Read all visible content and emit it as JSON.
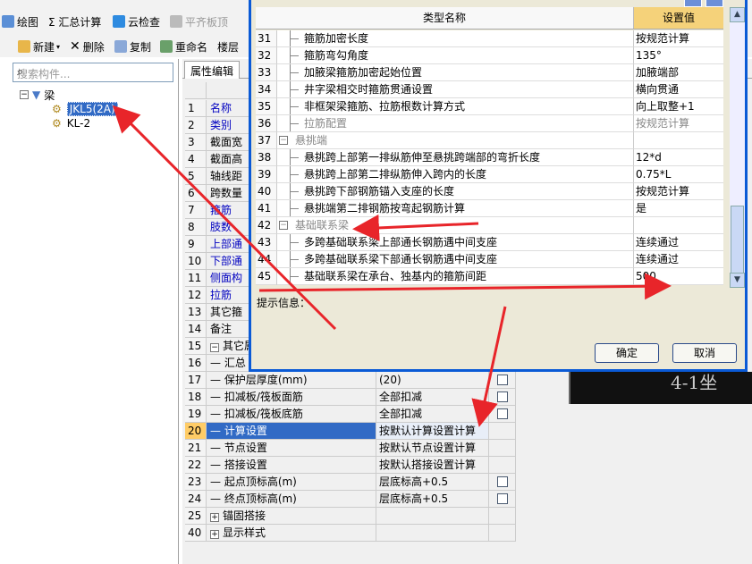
{
  "toolbar": {
    "row1": [
      "绘图",
      "Σ 汇总计算",
      "云检查",
      "平齐板顶"
    ],
    "row2": [
      "新建",
      "删除",
      "复制",
      "重命名",
      "楼层"
    ]
  },
  "left": {
    "search_placeholder": "搜索构件...",
    "tree_root": "梁",
    "items": [
      "JKL5(2A)",
      "KL-2"
    ]
  },
  "panel": {
    "tab": "属性编辑",
    "rows": [
      {
        "n": "1",
        "name": "名称",
        "v": "",
        "blue": true,
        "cb": false
      },
      {
        "n": "2",
        "name": "类别",
        "v": "",
        "blue": true,
        "cb": false
      },
      {
        "n": "3",
        "name": "截面宽",
        "v": "",
        "blue": false,
        "cb": false
      },
      {
        "n": "4",
        "name": "截面高",
        "v": "",
        "blue": false,
        "cb": false
      },
      {
        "n": "5",
        "name": "轴线距",
        "v": "",
        "blue": false,
        "cb": false
      },
      {
        "n": "6",
        "name": "跨数量",
        "v": "",
        "blue": false,
        "cb": false
      },
      {
        "n": "7",
        "name": "箍筋",
        "v": "",
        "blue": true,
        "cb": false
      },
      {
        "n": "8",
        "name": "肢数",
        "v": "",
        "blue": true,
        "cb": false
      },
      {
        "n": "9",
        "name": "上部通",
        "v": "",
        "blue": true,
        "cb": false
      },
      {
        "n": "10",
        "name": "下部通",
        "v": "",
        "blue": true,
        "cb": false
      },
      {
        "n": "11",
        "name": "侧面构",
        "v": "",
        "blue": true,
        "cb": false
      },
      {
        "n": "12",
        "name": "拉筋",
        "v": "",
        "blue": true,
        "cb": false
      },
      {
        "n": "13",
        "name": "其它箍",
        "v": "",
        "blue": false,
        "cb": false
      },
      {
        "n": "14",
        "name": "备注",
        "v": "",
        "blue": false,
        "cb": false
      },
      {
        "n": "15",
        "name": "其它属",
        "v": "",
        "blue": false,
        "cb": false,
        "exp": "−"
      },
      {
        "n": "16",
        "name": "— 汇总",
        "v": "",
        "blue": false,
        "cb": false
      },
      {
        "n": "17",
        "name": "— 保护层厚度(mm)",
        "v": "(20)",
        "blue": false,
        "cb": true
      },
      {
        "n": "18",
        "name": "— 扣减板/筏板面筋",
        "v": "全部扣减",
        "blue": false,
        "cb": true
      },
      {
        "n": "19",
        "name": "— 扣减板/筏板底筋",
        "v": "全部扣减",
        "blue": false,
        "cb": true
      },
      {
        "n": "20",
        "name": "— 计算设置",
        "v": "按默认计算设置计算",
        "blue": false,
        "cb": false,
        "hl": true
      },
      {
        "n": "21",
        "name": "— 节点设置",
        "v": "按默认节点设置计算",
        "blue": false,
        "cb": false
      },
      {
        "n": "22",
        "name": "— 搭接设置",
        "v": "按默认搭接设置计算",
        "blue": false,
        "cb": false
      },
      {
        "n": "23",
        "name": "— 起点顶标高(m)",
        "v": "层底标高+0.5",
        "blue": false,
        "cb": true
      },
      {
        "n": "24",
        "name": "— 终点顶标高(m)",
        "v": "层底标高+0.5",
        "blue": false,
        "cb": true
      },
      {
        "n": "25",
        "name": "锚固搭接",
        "v": "",
        "blue": false,
        "cb": false,
        "exp": "+"
      },
      {
        "n": "40",
        "name": "显示样式",
        "v": "",
        "blue": false,
        "cb": false,
        "exp": "+"
      }
    ]
  },
  "dialog": {
    "col_name": "类型名称",
    "col_value": "设置值",
    "rows": [
      {
        "n": "31",
        "name": "箍筋加密长度",
        "v": "按规范计算"
      },
      {
        "n": "32",
        "name": "箍筋弯勾角度",
        "v": "135°"
      },
      {
        "n": "33",
        "name": "加腋梁箍筋加密起始位置",
        "v": "加腋端部"
      },
      {
        "n": "34",
        "name": "井字梁相交时箍筋贯通设置",
        "v": "横向贯通"
      },
      {
        "n": "35",
        "name": "非框架梁箍筋、拉筋根数计算方式",
        "v": "向上取整+1"
      },
      {
        "n": "36",
        "name": "拉筋配置",
        "v": "按规范计算",
        "gray": true
      },
      {
        "n": "37",
        "name": "悬挑端",
        "v": "",
        "grp": true
      },
      {
        "n": "38",
        "name": "悬挑跨上部第一排纵筋伸至悬挑跨端部的弯折长度",
        "v": "12*d"
      },
      {
        "n": "39",
        "name": "悬挑跨上部第二排纵筋伸入跨内的长度",
        "v": "0.75*L"
      },
      {
        "n": "40",
        "name": "悬挑跨下部钢筋锚入支座的长度",
        "v": "按规范计算"
      },
      {
        "n": "41",
        "name": "悬挑端第二排钢筋按弯起钢筋计算",
        "v": "是"
      },
      {
        "n": "42",
        "name": "基础联系梁",
        "v": "",
        "grp": true
      },
      {
        "n": "43",
        "name": "多跨基础联系梁上部通长钢筋遇中间支座",
        "v": "连续通过"
      },
      {
        "n": "44",
        "name": "多跨基础联系梁下部通长钢筋遇中间支座",
        "v": "连续通过"
      },
      {
        "n": "45",
        "name": "基础联系梁在承台、独基内的箍筋间距",
        "v": "500"
      }
    ],
    "info_label": "提示信息：",
    "ok": "确定",
    "cancel": "取消"
  },
  "background_label": "4-1坐",
  "colors": {
    "arrow": "#e8252a",
    "accent": "#316ac5",
    "header_gold": "#f5d27a"
  }
}
